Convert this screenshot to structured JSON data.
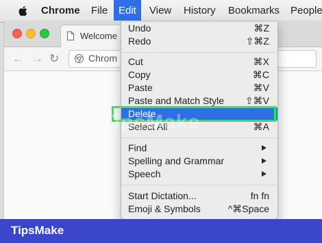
{
  "menubar": {
    "items": [
      {
        "label": "Chrome"
      },
      {
        "label": "File"
      },
      {
        "label": "Edit"
      },
      {
        "label": "View"
      },
      {
        "label": "History"
      },
      {
        "label": "Bookmarks"
      },
      {
        "label": "People"
      }
    ]
  },
  "browser": {
    "tab_title": "Welcome",
    "omnibox_text": "Chrom"
  },
  "edit_menu": {
    "items": [
      {
        "label": "Undo",
        "shortcut": "⌘Z"
      },
      {
        "label": "Redo",
        "shortcut": "⇧⌘Z"
      },
      {
        "label": "Cut",
        "shortcut": "⌘X"
      },
      {
        "label": "Copy",
        "shortcut": "⌘C"
      },
      {
        "label": "Paste",
        "shortcut": "⌘V"
      },
      {
        "label": "Paste and Match Style",
        "shortcut": "⇧⌘V"
      },
      {
        "label": "Delete",
        "shortcut": ""
      },
      {
        "label": "Select All",
        "shortcut": "⌘A"
      },
      {
        "label": "Find",
        "shortcut": ""
      },
      {
        "label": "Spelling and Grammar",
        "shortcut": ""
      },
      {
        "label": "Speech",
        "shortcut": ""
      },
      {
        "label": "Start Dictation...",
        "shortcut": "fn fn"
      },
      {
        "label": "Emoji & Symbols",
        "shortcut": "^⌘Space"
      }
    ],
    "selected": "Delete"
  },
  "watermark": "TipsMake",
  "footer": {
    "brand": "TipsMake"
  },
  "colors": {
    "accent": "#2f6fe6",
    "highlight_box": "#2ee84e",
    "footer": "#3a46c9"
  }
}
